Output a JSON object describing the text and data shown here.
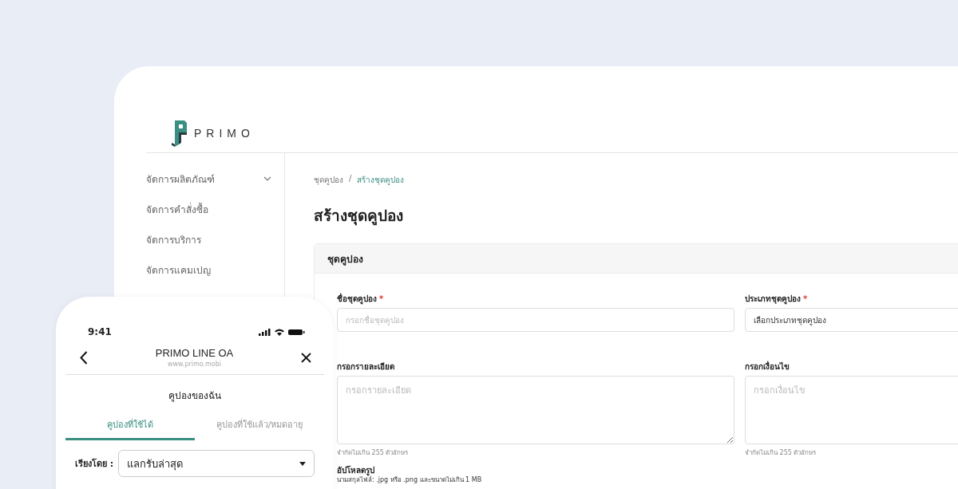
{
  "brand": {
    "name": "PRIMO"
  },
  "sidebar": {
    "items": [
      {
        "label": "จัดการผลิตภัณฑ์",
        "expandable": true
      },
      {
        "label": "จัดการคำสั่งซื้อ",
        "expandable": false
      },
      {
        "label": "จัดการบริการ",
        "expandable": false
      },
      {
        "label": "จัดการแคมเปญ",
        "expandable": false
      }
    ]
  },
  "breadcrumb": [
    {
      "label": "ชุดคูปอง",
      "current": false
    },
    {
      "label": "/",
      "current": false
    },
    {
      "label": "สร้างชุดคูปอง",
      "current": true
    }
  ],
  "page_title": "สร้างชุดคูปอง",
  "card": {
    "title": "ชุดคูปอง",
    "fields": [
      {
        "kind": "input",
        "label": "ชื่อชุดคูปอง",
        "required_mark": "*",
        "placeholder": "กรอกชื่อชุดคูปอง"
      },
      {
        "kind": "select",
        "label": "ประเภทชุดคูปอง",
        "required_mark": "*",
        "value": "เลือกประเภทชุดคูปอง"
      },
      {
        "kind": "textarea",
        "label": "กรอกรายละเอียด",
        "placeholder": "กรอกรายละเอียด",
        "hint": "จำกัดไม่เกิน 255 ตัวอักษร"
      },
      {
        "kind": "textarea",
        "label": "กรอกเงื่อนไข",
        "placeholder": "กรอกเงื่อนไข",
        "hint": "จำกัดไม่เกิน 255 ตัวอักษร"
      }
    ],
    "upload": {
      "label": "อัปโหลดรูป",
      "hint": "นามสกุลไฟล์: .jpg หรือ .png และขนาดไม่เกิน 1 MB"
    }
  },
  "phone": {
    "time": "9:41",
    "title": "PRIMO LINE OA",
    "url": "www.primo.mobi",
    "heading": "คูปองของฉัน",
    "tabs": [
      {
        "label": "คูปองที่ใช้ได้",
        "selected": true
      },
      {
        "label": "คูปองที่ใช้แล้ว/หมดอายุ",
        "selected": false
      }
    ],
    "sort": {
      "label": "เรียงโดย :",
      "value": "แลกรับล่าสุด"
    }
  }
}
